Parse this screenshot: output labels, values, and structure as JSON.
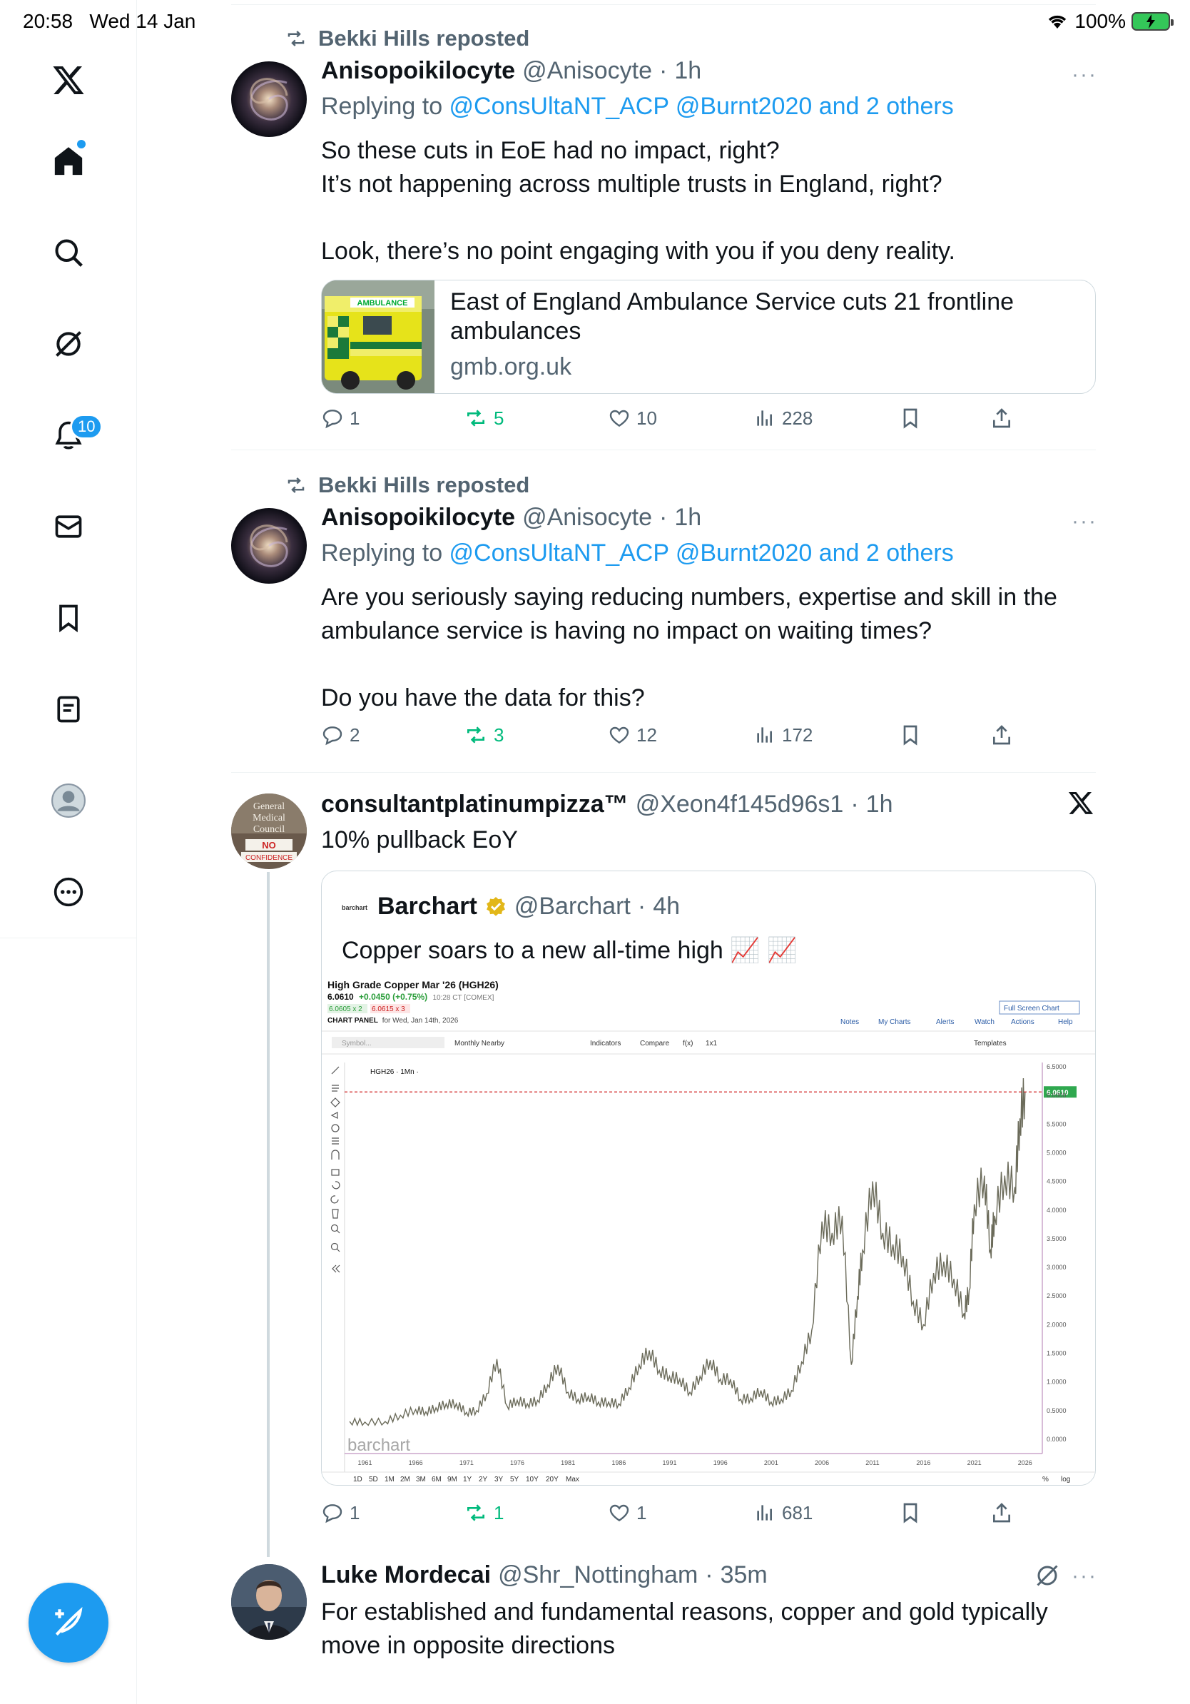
{
  "status_bar": {
    "time": "20:58",
    "date": "Wed 14 Jan",
    "battery": "100%"
  },
  "sidebar": {
    "notifications_badge": "10"
  },
  "tweets": [
    {
      "repost_by": "Bekki Hills reposted",
      "name": "Anisopoikilocyte",
      "handle": "@Anisocyte",
      "time": "1h",
      "replying_label": "Replying to ",
      "mentions": "@ConsUltaNT_ACP @Burnt2020 and 2 others",
      "text": "So these cuts in EoE had no impact, right?\nIt’s not happening across multiple trusts in England, right?\n\nLook, there’s no point engaging with you if you deny reality.",
      "link_card": {
        "title": "East of England Ambulance Service cuts 21 frontline ambulances",
        "domain": "gmb.org.uk",
        "image_text": "AMBULANCE"
      },
      "replies": "1",
      "reposts": "5",
      "likes": "10",
      "views": "228"
    },
    {
      "repost_by": "Bekki Hills reposted",
      "name": "Anisopoikilocyte",
      "handle": "@Anisocyte",
      "time": "1h",
      "replying_label": "Replying to ",
      "mentions": "@ConsUltaNT_ACP @Burnt2020 and 2 others",
      "text": "Are you seriously saying reducing numbers, expertise and skill in the ambulance service is having no impact on waiting times?\n\nDo you have the data for this?",
      "replies": "2",
      "reposts": "3",
      "likes": "12",
      "views": "172"
    },
    {
      "name": "consultantplatinumpizza™",
      "handle": "@Xeon4f145d96s1",
      "time": "1h",
      "text": "10% pullback EoY",
      "avatar_text": [
        "General",
        "Medical",
        "Council",
        "NO",
        "CONFIDENCE"
      ],
      "quote": {
        "name": "Barchart",
        "handle": "@Barchart",
        "time": "4h",
        "avatar_text": "barchart",
        "text": "Copper soars to a new all-time high 📈 📈"
      },
      "replies": "1",
      "reposts": "1",
      "likes": "1",
      "views": "681"
    },
    {
      "name": "Luke Mordecai",
      "handle": "@Shr_Nottingham",
      "time": "35m",
      "text": "For established and fundamental reasons, copper and gold typically move in opposite directions"
    }
  ],
  "chart_panel": {
    "title": "High Grade Copper Mar '26 (HGH26)",
    "price": "6.0610",
    "change": "+0.0450 (+0.75%)",
    "time": "10:28 CT [COMEX]",
    "bid": "6.0605 x 2",
    "ask": "6.0615 x 3",
    "panel_label": "CHART PANEL",
    "panel_date": "for Wed, Jan 14th, 2026",
    "full_screen": "Full Screen Chart",
    "menu": [
      "Notes",
      "My Charts",
      "Alerts",
      "Watch",
      "Actions",
      "Help"
    ],
    "toolbar": [
      "Symbol...",
      "Monthly Nearby",
      "Indicators",
      "Compare",
      "f(x)",
      "1x1",
      "Templates"
    ],
    "series_label": "HGH26 · 1Mn ·",
    "watermark": "barchart",
    "current_price_label": "6.0610",
    "ranges": [
      "1D",
      "5D",
      "1M",
      "2M",
      "3M",
      "6M",
      "9M",
      "1Y",
      "2Y",
      "3Y",
      "5Y",
      "10Y",
      "20Y",
      "Max"
    ],
    "scale_options": [
      "%",
      "log"
    ]
  },
  "chart_data": {
    "type": "line",
    "title": "High Grade Copper Mar '26 (HGH26)",
    "x_ticks": [
      "1961",
      "1966",
      "1971",
      "1976",
      "1981",
      "1986",
      "1991",
      "1996",
      "2001",
      "2006",
      "2011",
      "2016",
      "2021",
      "2026"
    ],
    "y_ticks": [
      "6.5000",
      "6.0000",
      "5.5000",
      "5.0000",
      "4.5000",
      "4.0000",
      "3.5000",
      "3.0000",
      "2.5000",
      "2.0000",
      "1.5000",
      "1.0000",
      "0.5000",
      "0.0000"
    ],
    "ylim": [
      0,
      6.5
    ],
    "xlim": [
      1959,
      2027
    ],
    "current_price": 6.061,
    "series": [
      {
        "values": [
          [
            1959.5,
            0.31
          ],
          [
            1961,
            0.3
          ],
          [
            1963,
            0.31
          ],
          [
            1964.5,
            0.42
          ],
          [
            1966,
            0.52
          ],
          [
            1967,
            0.48
          ],
          [
            1968,
            0.55
          ],
          [
            1969,
            0.62
          ],
          [
            1970,
            0.62
          ],
          [
            1971,
            0.47
          ],
          [
            1972,
            0.5
          ],
          [
            1973,
            0.8
          ],
          [
            1974,
            1.4
          ],
          [
            1975,
            0.58
          ],
          [
            1976,
            0.68
          ],
          [
            1977,
            0.62
          ],
          [
            1978,
            0.68
          ],
          [
            1979,
            0.95
          ],
          [
            1980,
            1.3
          ],
          [
            1981,
            0.82
          ],
          [
            1982,
            0.7
          ],
          [
            1983,
            0.75
          ],
          [
            1984,
            0.65
          ],
          [
            1985,
            0.65
          ],
          [
            1986,
            0.62
          ],
          [
            1987,
            0.9
          ],
          [
            1988,
            1.3
          ],
          [
            1989,
            1.55
          ],
          [
            1990,
            1.2
          ],
          [
            1991,
            1.1
          ],
          [
            1992,
            1.05
          ],
          [
            1993,
            0.82
          ],
          [
            1994,
            1.1
          ],
          [
            1995,
            1.38
          ],
          [
            1996,
            1.05
          ],
          [
            1997,
            1.05
          ],
          [
            1998,
            0.7
          ],
          [
            1999,
            0.72
          ],
          [
            2000,
            0.85
          ],
          [
            2001,
            0.65
          ],
          [
            2002,
            0.7
          ],
          [
            2003,
            0.85
          ],
          [
            2004,
            1.35
          ],
          [
            2005,
            1.9
          ],
          [
            2006,
            3.8
          ],
          [
            2007,
            3.6
          ],
          [
            2008,
            3.9
          ],
          [
            2008.9,
            1.3
          ],
          [
            2009.5,
            2.5
          ],
          [
            2010,
            3.3
          ],
          [
            2011,
            4.5
          ],
          [
            2012,
            3.6
          ],
          [
            2013,
            3.4
          ],
          [
            2014,
            3.2
          ],
          [
            2015,
            2.4
          ],
          [
            2016,
            2.0
          ],
          [
            2017,
            2.9
          ],
          [
            2018,
            3.1
          ],
          [
            2019,
            2.8
          ],
          [
            2020,
            2.2
          ],
          [
            2020.5,
            2.6
          ],
          [
            2021,
            4.1
          ],
          [
            2022,
            4.6
          ],
          [
            2022.6,
            3.3
          ],
          [
            2023,
            3.9
          ],
          [
            2024,
            4.6
          ],
          [
            2025,
            4.4
          ],
          [
            2025.5,
            5.6
          ],
          [
            2026,
            6.06
          ]
        ]
      }
    ]
  }
}
